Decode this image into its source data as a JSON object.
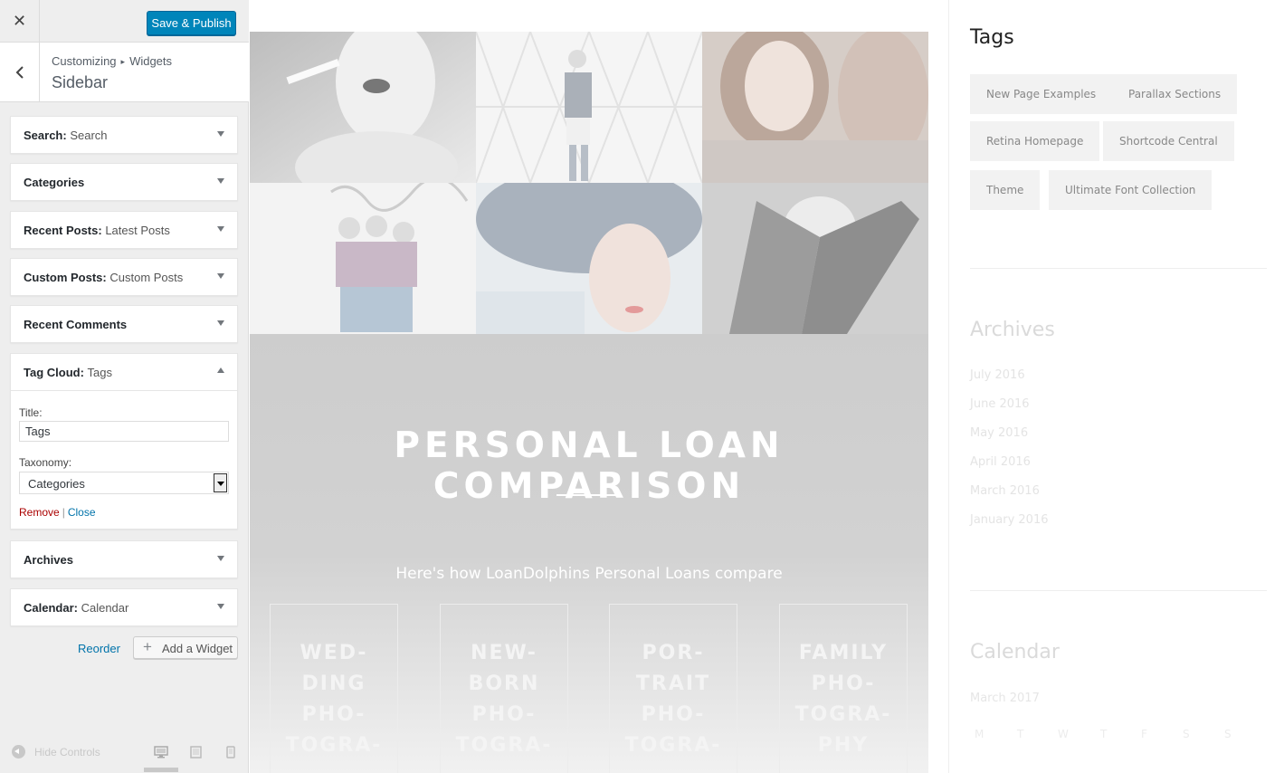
{
  "header": {
    "close_label": "✕",
    "save_label": "Save & Publish"
  },
  "section": {
    "breadcrumb_root": "Customizing",
    "breadcrumb_sep": "▸",
    "breadcrumb_child": "Widgets",
    "title": "Sidebar"
  },
  "widgets": [
    {
      "name": "Search",
      "instance": "Search",
      "sep": ": "
    },
    {
      "name": "Categories",
      "instance": "",
      "sep": ""
    },
    {
      "name": "Recent Posts",
      "instance": "Latest Posts",
      "sep": ": "
    },
    {
      "name": "Custom Posts",
      "instance": "Custom Posts",
      "sep": ": "
    },
    {
      "name": "Recent Comments",
      "instance": "",
      "sep": ""
    },
    {
      "name": "Tag Cloud",
      "instance": "Tags",
      "sep": ": "
    },
    {
      "name": "Archives",
      "instance": "",
      "sep": ""
    },
    {
      "name": "Calendar",
      "instance": "Calendar",
      "sep": ": "
    }
  ],
  "tag_cloud_form": {
    "title_label": "Title:",
    "title_value": "Tags",
    "taxonomy_label": "Taxonomy:",
    "taxonomy_value": "Categories",
    "remove_label": "Remove",
    "pipe": "|",
    "close_label": "Close"
  },
  "panel_actions": {
    "reorder_label": "Reorder",
    "add_widget_label": "Add a Widget",
    "add_widget_icon": "+"
  },
  "footer": {
    "hide_controls_label": "Hide Controls",
    "devices": [
      "desktop-icon",
      "tablet-icon",
      "mobile-icon"
    ]
  },
  "preview": {
    "loan_title": "PERSONAL LOAN COMPARISON",
    "loan_subtitle": "Here's how LoanDolphins Personal Loans compare",
    "cards": [
      "WED-\nDING\nPHO-\nTOGRA-",
      "NEW-\nBORN\nPHO-\nTOGRA-",
      "POR-\nTRAIT\nPHO-\nTOGRA-",
      "FAMILY\nPHO-\nTOGRA-\nPHY"
    ]
  },
  "sidebar_preview": {
    "tags_heading": "Tags",
    "tags": [
      "New Page Examples",
      "Parallax Sections",
      "Retina Homepage",
      "Shortcode Central",
      "Theme",
      "Ultimate Font Collection"
    ],
    "archives_heading": "Archives",
    "archives": [
      "July 2016",
      "June 2016",
      "May 2016",
      "April 2016",
      "March 2016",
      "January 2016"
    ],
    "calendar_heading": "Calendar",
    "calendar_month": "March 2017",
    "calendar_days": [
      "M",
      "T",
      "W",
      "T",
      "F",
      "S",
      "S"
    ]
  },
  "colors": {
    "primary_button": "#0085ba",
    "link": "#0073aa",
    "remove": "#aa0000",
    "panel_bg": "#eeeeee"
  }
}
